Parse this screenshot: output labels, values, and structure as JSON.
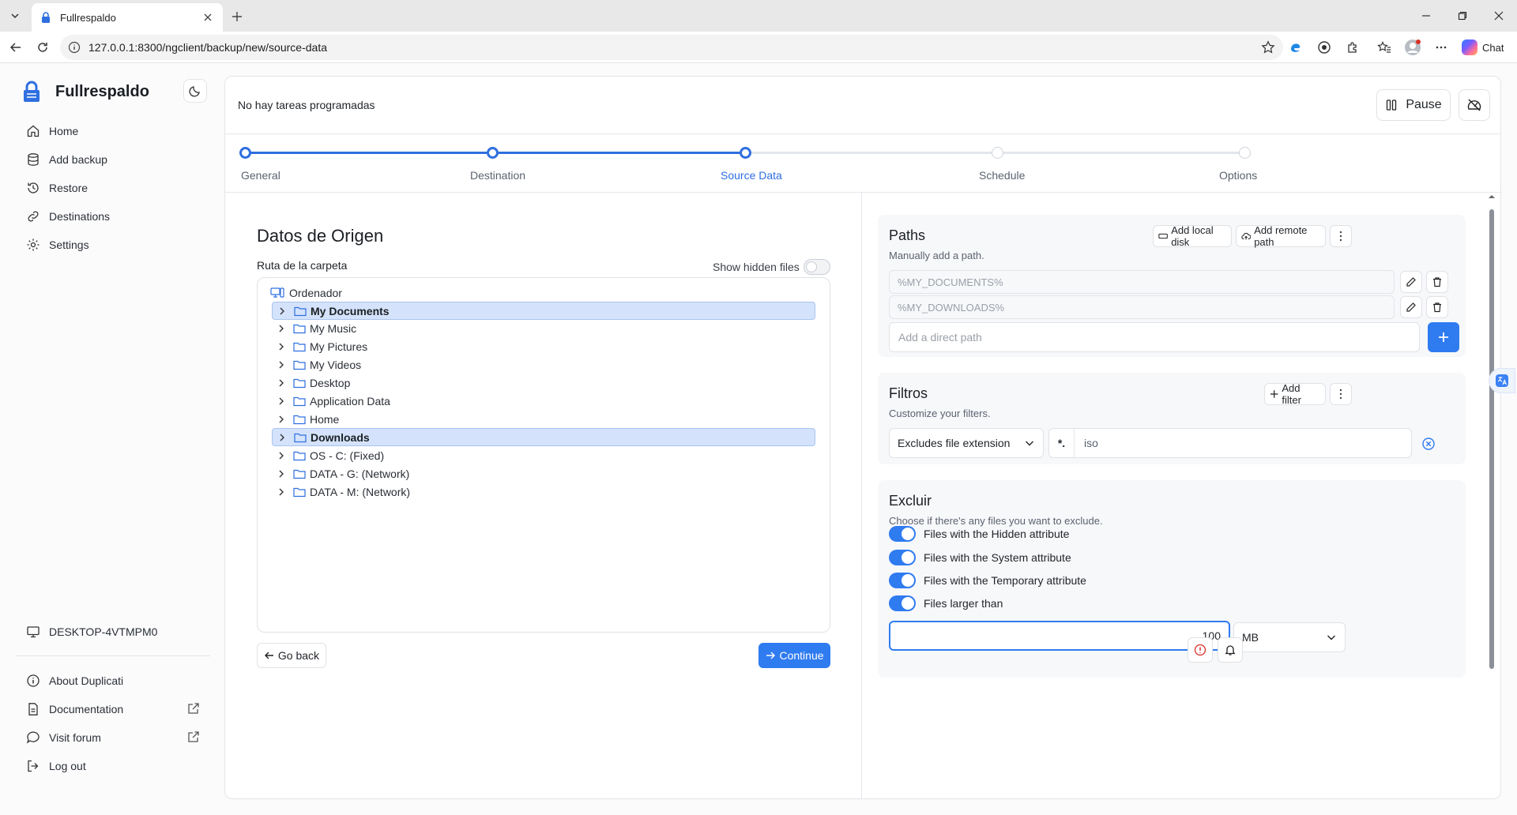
{
  "browser": {
    "tab_title": "Fullrespaldo",
    "url": "127.0.0.1:8300/ngclient/backup/new/source-data",
    "chat_label": "Chat"
  },
  "sidebar": {
    "app_name": "Fullrespaldo",
    "nav": [
      {
        "label": "Home",
        "icon": "home-icon"
      },
      {
        "label": "Add backup",
        "icon": "database-icon"
      },
      {
        "label": "Restore",
        "icon": "history-icon"
      },
      {
        "label": "Destinations",
        "icon": "link-icon"
      },
      {
        "label": "Settings",
        "icon": "gear-icon"
      }
    ],
    "machine": "DESKTOP-4VTMPM0",
    "footer": [
      {
        "label": "About Duplicati",
        "icon": "info-icon"
      },
      {
        "label": "Documentation",
        "icon": "document-icon"
      },
      {
        "label": "Visit forum",
        "icon": "chat-bubble-icon"
      },
      {
        "label": "Log out",
        "icon": "logout-icon"
      }
    ]
  },
  "top": {
    "status": "No hay tareas programadas",
    "pause_label": "Pause"
  },
  "steps": [
    {
      "label": "General",
      "state": "done"
    },
    {
      "label": "Destination",
      "state": "done"
    },
    {
      "label": "Source Data",
      "state": "active"
    },
    {
      "label": "Schedule",
      "state": "todo"
    },
    {
      "label": "Options",
      "state": "todo"
    }
  ],
  "source": {
    "title": "Datos de Origen",
    "folder_label": "Ruta de la carpeta",
    "show_hidden_label": "Show hidden files",
    "show_hidden": false,
    "root": "Ordenador",
    "items": [
      {
        "label": "My Documents",
        "selected": true
      },
      {
        "label": "My Music",
        "selected": false
      },
      {
        "label": "My Pictures",
        "selected": false
      },
      {
        "label": "My Videos",
        "selected": false
      },
      {
        "label": "Desktop",
        "selected": false
      },
      {
        "label": "Application Data",
        "selected": false
      },
      {
        "label": "Home",
        "selected": false
      },
      {
        "label": "Downloads",
        "selected": true
      },
      {
        "label": "OS - C: (Fixed)",
        "selected": false
      },
      {
        "label": "DATA - G: (Network)",
        "selected": false
      },
      {
        "label": "DATA - M: (Network)",
        "selected": false
      }
    ],
    "back_label": "Go back",
    "continue_label": "Continue"
  },
  "paths": {
    "title": "Paths",
    "subtitle": "Manually add a path.",
    "add_local_label": "Add local disk",
    "add_remote_label": "Add remote path",
    "entries": [
      "%MY_DOCUMENTS%",
      "%MY_DOWNLOADS%"
    ],
    "direct_placeholder": "Add a direct path"
  },
  "filters": {
    "title": "Filtros",
    "subtitle": "Customize your filters.",
    "add_label": "Add filter",
    "type": "Excludes file extension",
    "prefix": "*.",
    "value": "iso"
  },
  "exclude": {
    "title": "Excluir",
    "subtitle": "Choose if there's any files you want to exclude.",
    "options": [
      {
        "label": "Files with the Hidden attribute",
        "on": true
      },
      {
        "label": "Files with the System attribute",
        "on": true
      },
      {
        "label": "Files with the Temporary attribute",
        "on": true
      },
      {
        "label": "Files larger than",
        "on": true
      }
    ],
    "size_value": "100",
    "size_unit": "MB"
  },
  "colors": {
    "accent": "#2f7bf0",
    "selected_row": "#d4e3fb",
    "brand_logo": "#2f6fe0"
  }
}
